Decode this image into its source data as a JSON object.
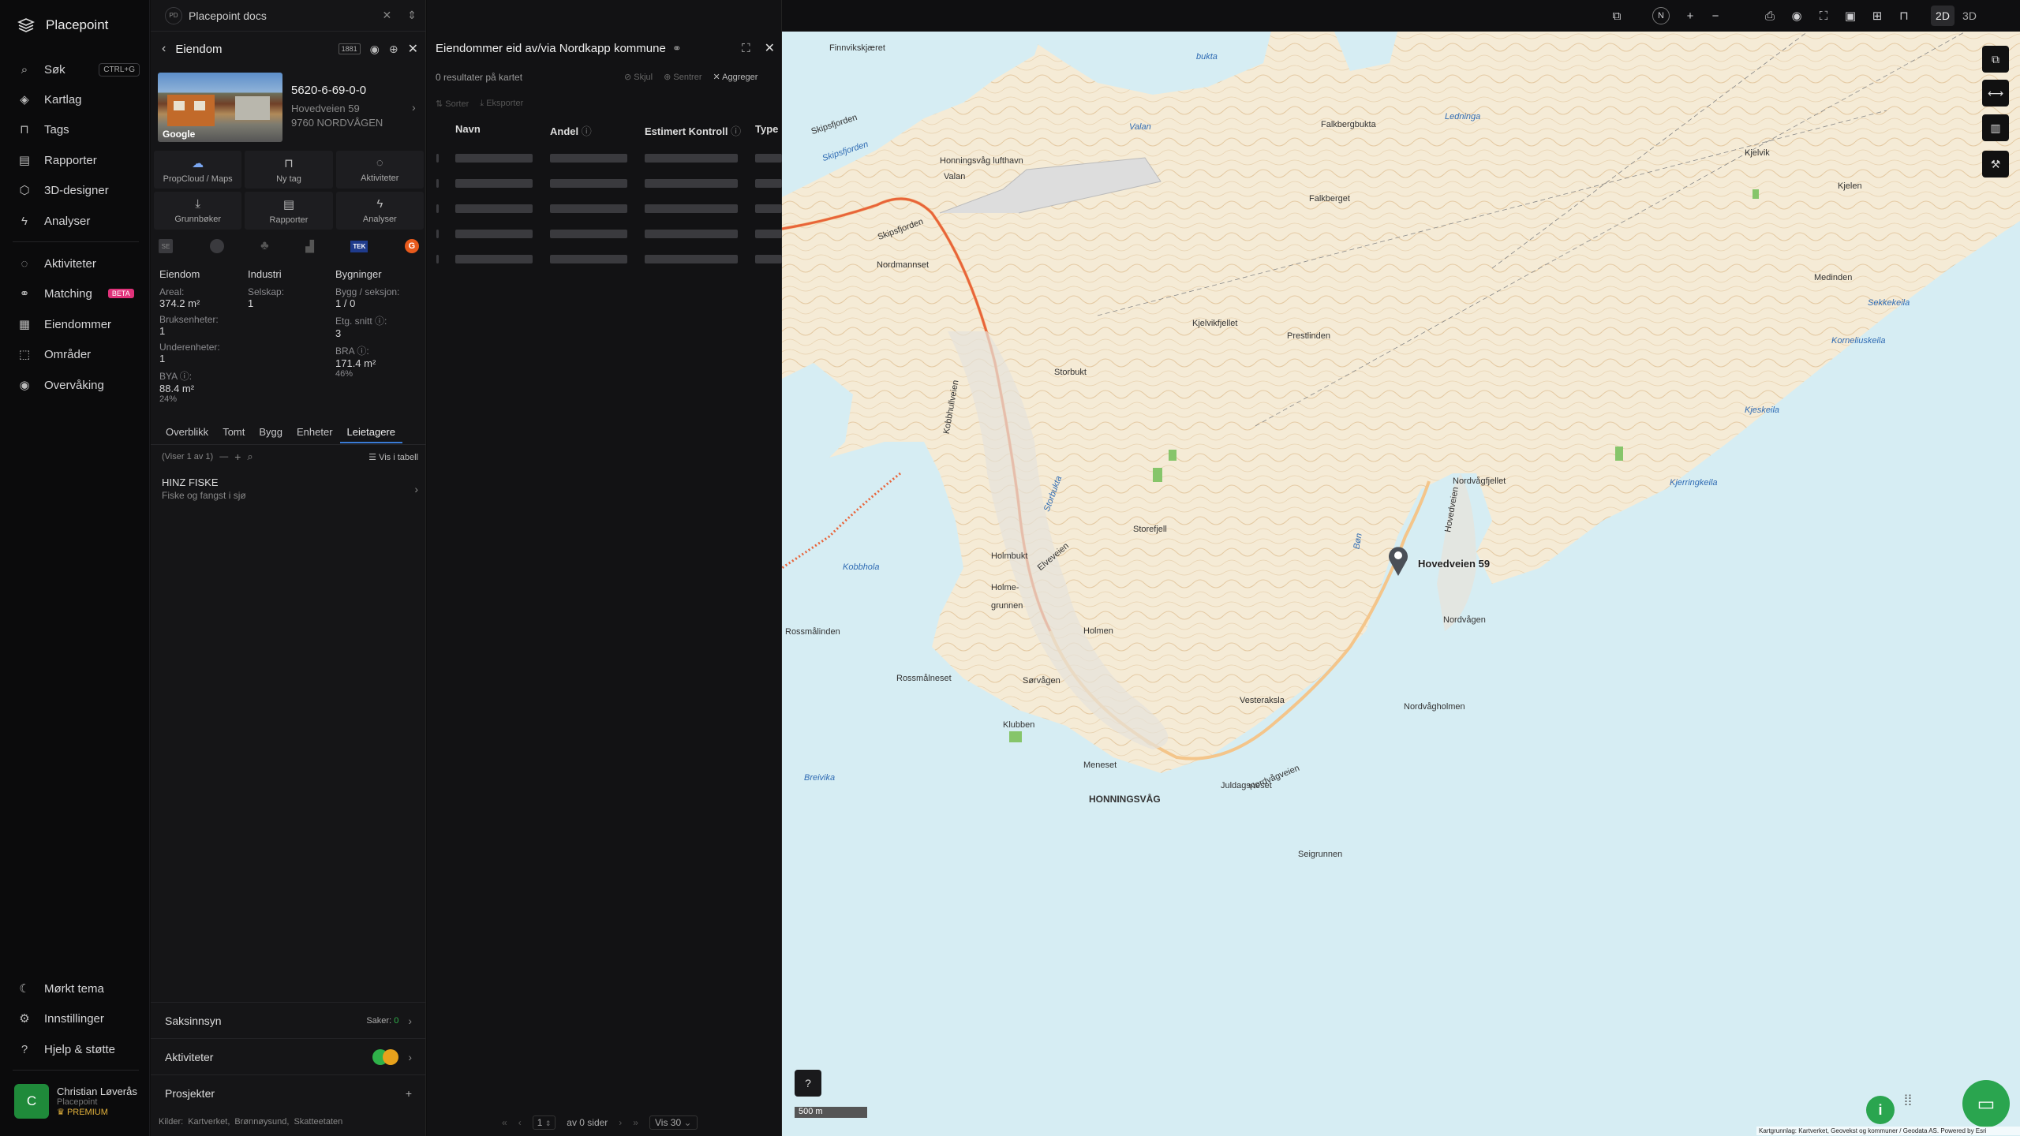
{
  "app": {
    "name": "Placepoint"
  },
  "nav": {
    "items": [
      {
        "label": "Søk",
        "shortcut": "CTRL+G",
        "icon": "search-icon"
      },
      {
        "label": "Kartlag",
        "icon": "layers-icon"
      },
      {
        "label": "Tags",
        "icon": "bookmark-icon"
      },
      {
        "label": "Rapporter",
        "icon": "chart-icon"
      },
      {
        "label": "3D-designer",
        "icon": "cube-icon"
      },
      {
        "label": "Analyser",
        "icon": "bolt-icon"
      },
      {
        "label": "Aktiviteter",
        "icon": "chat-icon"
      },
      {
        "label": "Matching",
        "badge": "BETA",
        "icon": "handshake-icon"
      },
      {
        "label": "Eiendommer",
        "icon": "building-icon"
      },
      {
        "label": "Områder",
        "icon": "area-icon"
      },
      {
        "label": "Overvåking",
        "icon": "eye-icon"
      }
    ],
    "bottom": [
      {
        "label": "Mørkt tema",
        "icon": "moon-icon"
      },
      {
        "label": "Innstillinger",
        "icon": "gear-icon"
      },
      {
        "label": "Hjelp & støtte",
        "icon": "help-icon"
      }
    ],
    "user": {
      "initial": "C",
      "name": "Christian Løverås",
      "org": "Placepoint",
      "plan": "PREMIUM"
    }
  },
  "workspace": {
    "badge": "PD",
    "name": "Placepoint docs"
  },
  "property": {
    "panel_title": "Eiendom",
    "id": "5620-6-69-0-0",
    "street": "Hovedveien 59",
    "postal": "9760 NORDVÅGEN",
    "photo_credit": "Google",
    "actions": [
      {
        "label": "PropCloud / Maps",
        "icon": "cloud-icon"
      },
      {
        "label": "Ny tag",
        "icon": "bookmark-icon"
      },
      {
        "label": "Aktiviteter",
        "icon": "chat-icon"
      },
      {
        "label": "Grunnbøker",
        "icon": "download-icon"
      },
      {
        "label": "Rapporter",
        "icon": "chart-icon"
      },
      {
        "label": "Analyser",
        "icon": "bolt-icon"
      }
    ],
    "source_tiles": [
      "SE",
      "TEK",
      "G"
    ],
    "columns": [
      {
        "heading": "Eiendom",
        "rows": [
          {
            "label": "Areal:",
            "value": "374.2 m²"
          },
          {
            "label": "Bruksenheter:",
            "value": "1"
          },
          {
            "label": "Underenheter:",
            "value": "1"
          },
          {
            "label": "BYA ⓘ:",
            "value": "88.4 m²",
            "sub": "24%"
          }
        ]
      },
      {
        "heading": "Industri",
        "rows": [
          {
            "label": "Selskap:",
            "value": "1"
          }
        ]
      },
      {
        "heading": "Bygninger",
        "rows": [
          {
            "label": "Bygg / seksjon:",
            "value": "1 / 0"
          },
          {
            "label": "Etg. snitt ⓘ:",
            "value": "3"
          },
          {
            "label": "BRA ⓘ:",
            "value": "171.4 m²",
            "sub": "46%"
          }
        ]
      }
    ],
    "tabs": [
      "Overblikk",
      "Tomt",
      "Bygg",
      "Enheter",
      "Leietagere"
    ],
    "active_tab": "Leietagere",
    "tenants_paging": "(Viser 1 av 1)",
    "view_table": "Vis i tabell",
    "tenant": {
      "name": "HINZ FISKE",
      "category": "Fiske og fangst i sjø"
    },
    "sections": [
      {
        "label": "Saksinnsyn",
        "extra_label": "Saker:",
        "extra_value": "0"
      },
      {
        "label": "Aktiviteter"
      },
      {
        "label": "Prosjekter"
      }
    ],
    "sources_label": "Kilder:",
    "sources": [
      "Kartverket,",
      "Brønnøysund,",
      "Skatteetaten"
    ]
  },
  "list": {
    "title": "Eiendommer eid av/via Nordkapp kommune",
    "results": "0 resultater på kartet",
    "actions": [
      "Skjul",
      "Sentrer",
      "Aggreger"
    ],
    "sub_actions": [
      "Sorter",
      "Eksporter"
    ],
    "columns": [
      "Navn",
      "Andel",
      "Estimert Kontroll",
      "Type"
    ],
    "pager": {
      "page": "1",
      "of_pages": "av 0 sider",
      "per_page": "Vis 30"
    }
  },
  "map": {
    "view_modes": [
      "2D",
      "3D"
    ],
    "active_mode": "2D",
    "compass": "N",
    "scale": "500 m",
    "attribution": "Kartgrunnlag: Kartverket, Geovekst og kommuner / Geodata AS. Powered by Esri",
    "marker_label": "Hovedveien 59",
    "labels": [
      {
        "t": "Finnvikskjæret",
        "w": false
      },
      {
        "t": "bukta",
        "w": true
      },
      {
        "t": "Skipsfjorden",
        "w": true
      },
      {
        "t": "Skipsfjorden",
        "w": false
      },
      {
        "t": "Valan",
        "w": true
      },
      {
        "t": "Honningsvåg lufthavn",
        "w": false
      },
      {
        "t": "Valan",
        "w": false
      },
      {
        "t": "Falkbergbukta",
        "w": false
      },
      {
        "t": "Falkberget",
        "w": false
      },
      {
        "t": "Ledninga",
        "w": true
      },
      {
        "t": "Kjelvik",
        "w": false
      },
      {
        "t": "Kjelen",
        "w": false
      },
      {
        "t": "Nordmannset",
        "w": false
      },
      {
        "t": "Medinden",
        "w": false
      },
      {
        "t": "Sekkekeila",
        "w": true
      },
      {
        "t": "Korneliuskeila",
        "w": true
      },
      {
        "t": "Kjelvikfjellet",
        "w": false
      },
      {
        "t": "Prestlinden",
        "w": false
      },
      {
        "t": "Storbukt",
        "w": false
      },
      {
        "t": "Kjeskeila",
        "w": true
      },
      {
        "t": "Nordvågfjellet",
        "w": false
      },
      {
        "t": "Kjerringkeila",
        "w": true
      },
      {
        "t": "Storefjell",
        "w": false
      },
      {
        "t": "Kobbhola",
        "w": true
      },
      {
        "t": "Holmbukt",
        "w": false
      },
      {
        "t": "Holme-",
        "w": false
      },
      {
        "t": "grunnen",
        "w": false
      },
      {
        "t": "Rossmålinden",
        "w": false
      },
      {
        "t": "Holmen",
        "w": false
      },
      {
        "t": "Nordvågen",
        "w": false
      },
      {
        "t": "Rossmålneset",
        "w": false
      },
      {
        "t": "Sørvågen",
        "w": false
      },
      {
        "t": "Vesteraksla",
        "w": false
      },
      {
        "t": "Nordvågholmen",
        "w": false
      },
      {
        "t": "Klubben",
        "w": false
      },
      {
        "t": "Nordvågveien",
        "w": false
      },
      {
        "t": "Meneset",
        "w": false
      },
      {
        "t": "Breivika",
        "w": true
      },
      {
        "t": "Juldagsneset",
        "w": false
      },
      {
        "t": "HONNINGSVÅG",
        "w": false
      },
      {
        "t": "Seigrunnen",
        "w": false
      },
      {
        "t": "Storbukta",
        "w": true
      },
      {
        "t": "Bøn",
        "w": true
      },
      {
        "t": "Kobbhullveien",
        "w": false
      },
      {
        "t": "Elveveien",
        "w": false
      },
      {
        "t": "Skipsfjorden",
        "w": false
      },
      {
        "t": "Hovedveien",
        "w": false
      }
    ]
  }
}
